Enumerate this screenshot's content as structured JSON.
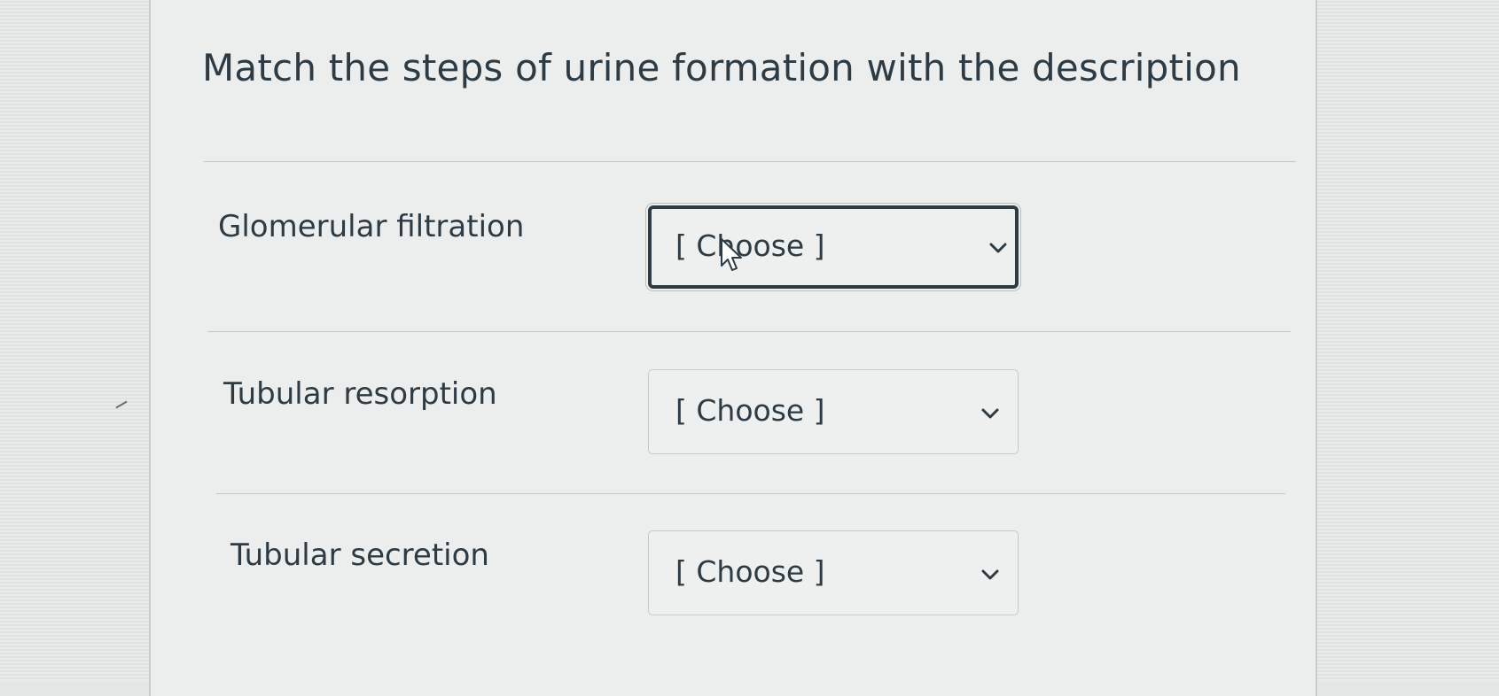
{
  "question": {
    "title": "Match the steps of urine formation with the description"
  },
  "rows": [
    {
      "label": "Glomerular filtration",
      "select_value": "[ Choose ]"
    },
    {
      "label": "Tubular resorption",
      "select_value": "[ Choose ]"
    },
    {
      "label": "Tubular secretion",
      "select_value": "[ Choose ]"
    }
  ],
  "icons": {
    "dropdown": "chevron-down-icon",
    "pointer": "mouse-pointer-icon"
  },
  "colors": {
    "text": "#2d3b45",
    "focus_border": "#2d3b45",
    "field_border": "#c5cac8",
    "background": "#eceeed"
  }
}
